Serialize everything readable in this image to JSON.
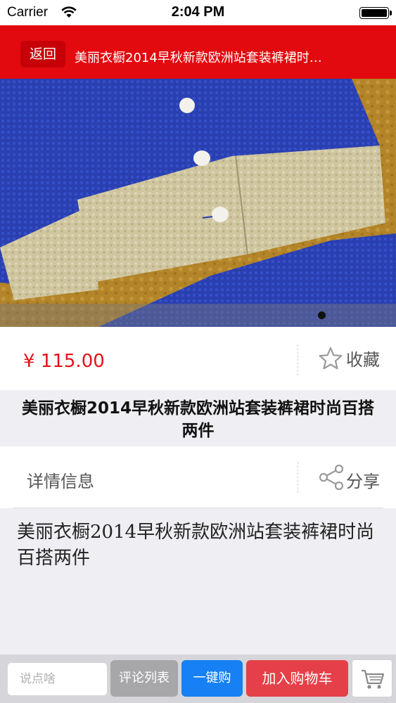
{
  "status_bar": {
    "carrier": "Carrier",
    "time": "2:04 PM"
  },
  "navbar": {
    "back_label": "返回",
    "title": "美丽衣橱2014早秋新款欧洲站套装裤裙时…",
    "background_color": "#e20a0f"
  },
  "gallery": {
    "image_subject": "blue jacket sleeve with gold lace cuff and white buttons",
    "page_indicator": {
      "current": 1,
      "total": 1
    }
  },
  "product": {
    "price": "¥ 115.00",
    "price_color": "#e2141a",
    "favorite_label": "收藏",
    "favorite_icon": "star-outline-icon",
    "title": "美丽衣橱2014早秋新款欧洲站套装裤裙时尚百搭两件",
    "details_label": "详情信息",
    "share_label": "分享",
    "share_icon": "share-icon",
    "description": "美丽衣橱2014早秋新款欧洲站套装裤裙时尚百搭两件"
  },
  "bottom_bar": {
    "comment_placeholder": "说点啥",
    "reviews_label": "评论列表",
    "buy_now_label": "一键购",
    "add_to_cart_label": "加入购物车",
    "cart_icon": "shopping-cart-icon",
    "buy_now_color": "#1680f4",
    "add_to_cart_color": "#e54049"
  }
}
